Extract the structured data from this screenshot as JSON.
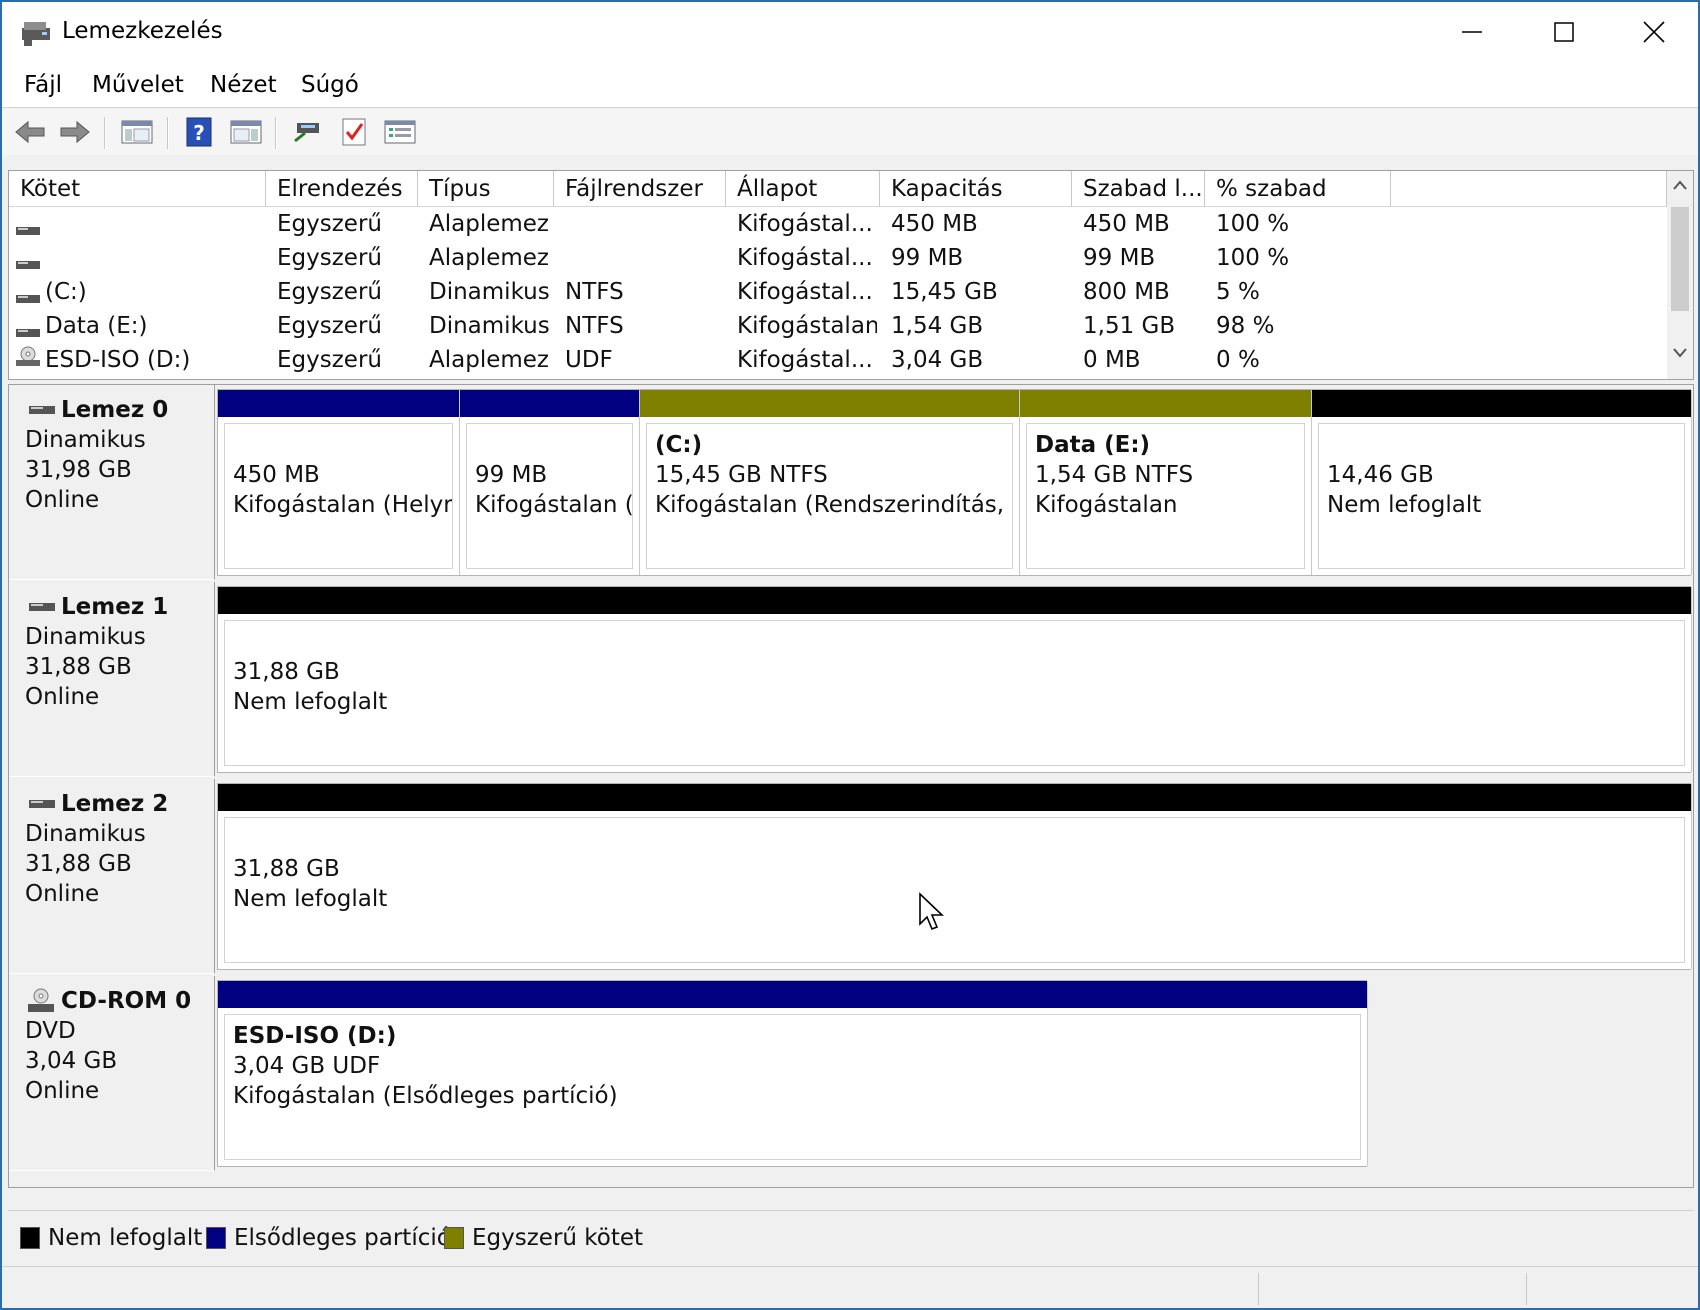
{
  "window": {
    "title": "Lemezkezelés"
  },
  "menu": [
    "Fájl",
    "Művelet",
    "Nézet",
    "Súgó"
  ],
  "toolbar": [
    {
      "icon": "back-arrow-icon"
    },
    {
      "icon": "forward-arrow-icon"
    },
    {
      "icon": "console-tree-icon"
    },
    {
      "icon": "help-icon"
    },
    {
      "icon": "action-pane-icon"
    },
    {
      "icon": "connect-disk-icon"
    },
    {
      "icon": "checklist-icon"
    },
    {
      "icon": "properties-list-icon"
    }
  ],
  "volume_list": {
    "columns": [
      "Kötet",
      "Elrendezés",
      "Típus",
      "Fájlrendszer",
      "Állapot",
      "Kapacitás",
      "Szabad l...",
      "% szabad"
    ],
    "rows": [
      {
        "icon": "drive-icon",
        "volume": "",
        "layout": "Egyszerű",
        "type": "Alaplemez",
        "fs": "",
        "status": "Kifogástal...",
        "capacity": "450 MB",
        "free": "450 MB",
        "pct": "100 %"
      },
      {
        "icon": "drive-icon",
        "volume": "",
        "layout": "Egyszerű",
        "type": "Alaplemez",
        "fs": "",
        "status": "Kifogástal...",
        "capacity": "99 MB",
        "free": "99 MB",
        "pct": "100 %"
      },
      {
        "icon": "drive-icon",
        "volume": " (C:)",
        "layout": "Egyszerű",
        "type": "Dinamikus",
        "fs": "NTFS",
        "status": "Kifogástal...",
        "capacity": "15,45 GB",
        "free": "800 MB",
        "pct": "5 %"
      },
      {
        "icon": "drive-icon",
        "volume": "Data (E:)",
        "layout": "Egyszerű",
        "type": "Dinamikus",
        "fs": "NTFS",
        "status": "Kifogástalan",
        "capacity": "1,54 GB",
        "free": "1,51 GB",
        "pct": "98 %"
      },
      {
        "icon": "cd-drive-icon",
        "volume": "ESD-ISO (D:)",
        "layout": "Egyszerű",
        "type": "Alaplemez",
        "fs": "UDF",
        "status": "Kifogástal...",
        "capacity": "3,04 GB",
        "free": "0 MB",
        "pct": "0 %"
      }
    ]
  },
  "disks": [
    {
      "name": "Lemez 0",
      "kind": "Dinamikus",
      "size": "31,98 GB",
      "state": "Online",
      "partitions": [
        {
          "name": "",
          "line1": "450 MB",
          "line2": "Kifogástalan (Helyreállítási partíció)",
          "color": "#000080"
        },
        {
          "name": "",
          "line1": "99 MB",
          "line2": "Kifogástalan (EFI rendszerpartíció)",
          "color": "#000080"
        },
        {
          "name": " (C:)",
          "line1": "15,45 GB NTFS",
          "line2": "Kifogástalan (Rendszerindítás, Lapozófájl, Összeomlási memóriakép)",
          "color": "#808000"
        },
        {
          "name": "Data  (E:)",
          "line1": "1,54 GB NTFS",
          "line2": "Kifogástalan",
          "color": "#808000"
        },
        {
          "name": "",
          "line1": "14,46 GB",
          "line2": "Nem lefoglalt",
          "color": "#000000"
        }
      ]
    },
    {
      "name": "Lemez 1",
      "kind": "Dinamikus",
      "size": "31,88 GB",
      "state": "Online",
      "partitions": [
        {
          "name": "",
          "line1": "31,88 GB",
          "line2": "Nem lefoglalt",
          "color": "#000000"
        }
      ]
    },
    {
      "name": "Lemez 2",
      "kind": "Dinamikus",
      "size": "31,88 GB",
      "state": "Online",
      "partitions": [
        {
          "name": "",
          "line1": "31,88 GB",
          "line2": "Nem lefoglalt",
          "color": "#000000"
        }
      ]
    },
    {
      "name": "CD-ROM 0",
      "kind": "DVD",
      "size": "3,04 GB",
      "state": "Online",
      "partitions": [
        {
          "name": "ESD-ISO  (D:)",
          "line1": "3,04 GB UDF",
          "line2": "Kifogástalan (Elsődleges partíció)",
          "color": "#000080"
        }
      ]
    }
  ],
  "legend": [
    {
      "label": "Nem lefoglalt",
      "color": "#000000"
    },
    {
      "label": "Elsődleges partíció",
      "color": "#000080"
    },
    {
      "label": "Egyszerű kötet",
      "color": "#808000"
    }
  ]
}
